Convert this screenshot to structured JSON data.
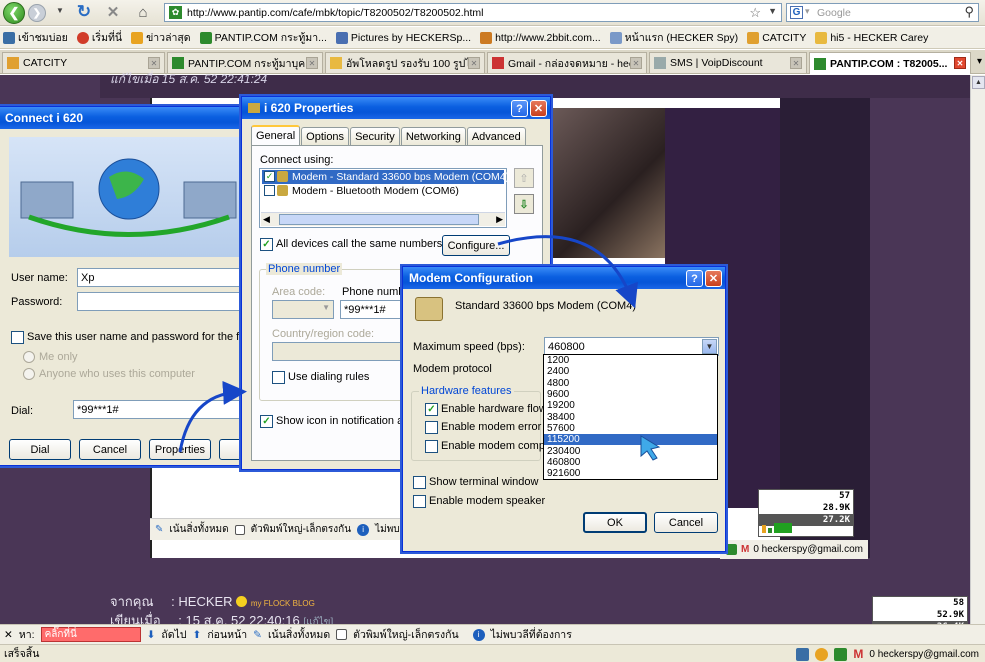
{
  "browser": {
    "url": "http://www.pantip.com/cafe/mbk/topic/T8200502/T8200502.html",
    "search_placeholder": "Google",
    "bookmarks": [
      {
        "label": "เข้าชมบ่อย",
        "color": "#3a6ea5"
      },
      {
        "label": "เริ่มที่นี่",
        "color": "#d13c2a"
      },
      {
        "label": "ข่าวล่าสุด",
        "color": "#e8a321"
      },
      {
        "label": "PANTIP.COM กระทู้มา...",
        "color": "#2d8a2d"
      },
      {
        "label": "Pictures by HECKERSp...",
        "color": "#4a6fb1"
      },
      {
        "label": "http://www.2bbit.com...",
        "color": "#cc7a22"
      },
      {
        "label": "หน้าแรก (HECKER Spy)",
        "color": "#7a99c8"
      },
      {
        "label": "CATCITY",
        "color": "#e0a030"
      },
      {
        "label": "hi5 - HECKER Carey",
        "color": "#e8b940"
      }
    ],
    "tabs": [
      {
        "label": "CATCITY",
        "color": "#e0a030"
      },
      {
        "label": "PANTIP.COM กระทู้มาบุค...",
        "color": "#2d8a2d"
      },
      {
        "label": "อัพโหลดรูป รองรับ 100 รูปไ...",
        "color": "#e8b940"
      },
      {
        "label": "Gmail - กล่องจดหมาย - hec...",
        "color": "#c33"
      },
      {
        "label": "SMS | VoipDiscount",
        "color": "#9aa"
      },
      {
        "label": "PANTIP.COM : T82005...",
        "color": "#2d8a2d"
      }
    ]
  },
  "page": {
    "edited_text": "แก้ไขเมื่อ 15 ส.ค. 52 22:41:24",
    "from_label": "จากคุณ",
    "from_name": ": HECKER",
    "from_badge": "my FLOCK BLOG",
    "posted_label": "เขียนเมื่อ",
    "posted_time": ": 15 ส.ค. 52 22:40:16",
    "posted_small": "[แก้ไข]",
    "inner_find": {
      "highlight_all": "เน้นสิ่งทั้งหมด",
      "match_case": "ตัวพิมพ์ใหญ่-เล็กตรงกัน",
      "not_found": "ไม่พบวลีที่ต้องการ"
    },
    "inner_status_email": "0 heckerspy@gmail.com",
    "netmon_inner": {
      "row1": "57",
      "row2": "28.9K",
      "row3": "27.2K"
    },
    "netmon_outer": {
      "row1": "58",
      "row2": "52.9K",
      "row3": "26.4K"
    }
  },
  "find_bar": {
    "close": "✕",
    "label": "หา:",
    "value": "คลิ๊กที่นี่",
    "next": "ถัดไป",
    "prev": "ก่อนหน้า",
    "highlight_all": "เน้นสิ่งทั้งหมด",
    "match_case": "ตัวพิมพ์ใหญ่-เล็กตรงกัน",
    "not_found": "ไม่พบวลีที่ต้องการ"
  },
  "status_bar": {
    "text": "เสร็จสิ้น",
    "email": "0 heckerspy@gmail.com"
  },
  "connect_dialog": {
    "title": "Connect i 620",
    "username_label": "User name:",
    "username_value": "Xp",
    "password_label": "Password:",
    "save_label": "Save this user name and password for the following u",
    "me_only": "Me only",
    "anyone": "Anyone who uses this computer",
    "dial_label": "Dial:",
    "dial_value": "*99***1#",
    "btn_dial": "Dial",
    "btn_cancel": "Cancel",
    "btn_properties": "Properties"
  },
  "props_dialog": {
    "title": "i 620 Properties",
    "tabs": [
      "General",
      "Options",
      "Security",
      "Networking",
      "Advanced"
    ],
    "connect_using": "Connect using:",
    "modems": [
      {
        "label": "Modem - Standard 33600 bps Modem (COM4)",
        "checked": true
      },
      {
        "label": "Modem - Bluetooth Modem (COM6)",
        "checked": false
      }
    ],
    "all_devices": "All devices call the same numbers",
    "configure": "Configure...",
    "phone_group": "Phone number",
    "area_code": "Area code:",
    "phone_number": "Phone number",
    "phone_value": "*99***1#",
    "country": "Country/region code:",
    "dialing_rules": "Use dialing rules",
    "show_icon": "Show icon in notification area w"
  },
  "modem_dialog": {
    "title": "Modem Configuration",
    "modem_name": "Standard 33600 bps Modem (COM4)",
    "max_speed_label": "Maximum speed (bps):",
    "max_speed_value": "460800",
    "speeds": [
      "1200",
      "2400",
      "4800",
      "9600",
      "19200",
      "38400",
      "57600",
      "115200",
      "230400",
      "460800",
      "921600"
    ],
    "selected_speed": "115200",
    "protocol_label": "Modem protocol",
    "hw_group": "Hardware features",
    "hw_flow": "Enable hardware flow cor",
    "error_ctrl": "Enable modem error contr",
    "compression": "Enable modem compressi",
    "terminal": "Show terminal window",
    "speaker": "Enable modem speaker",
    "ok": "OK",
    "cancel": "Cancel"
  }
}
